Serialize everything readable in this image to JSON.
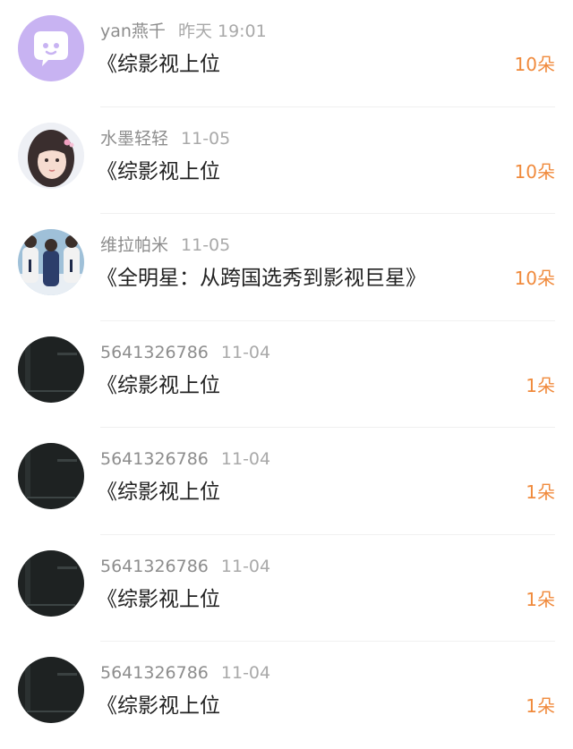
{
  "colors": {
    "accent": "#f08a3c",
    "name_text": "#8d8d8d",
    "title_text": "#222222",
    "divider": "#f0f0f0"
  },
  "gifts": [
    {
      "user": "yan燕千",
      "time": "昨天 19:01",
      "title": "《综影视上位",
      "amount": "10朵",
      "avatar": "purple-chat-bubble-avatar"
    },
    {
      "user": "水墨轻轻",
      "time": "11-05",
      "title": "《综影视上位",
      "amount": "10朵",
      "avatar": "girl-portrait-avatar"
    },
    {
      "user": "维拉帕米",
      "time": "11-05",
      "title": "《全明星：从跨国选秀到影视巨星》",
      "amount": "10朵",
      "avatar": "group-photo-avatar"
    },
    {
      "user": "5641326786",
      "time": "11-04",
      "title": "《综影视上位",
      "amount": "1朵",
      "avatar": "dark-image-avatar"
    },
    {
      "user": "5641326786",
      "time": "11-04",
      "title": "《综影视上位",
      "amount": "1朵",
      "avatar": "dark-image-avatar"
    },
    {
      "user": "5641326786",
      "time": "11-04",
      "title": "《综影视上位",
      "amount": "1朵",
      "avatar": "dark-image-avatar"
    },
    {
      "user": "5641326786",
      "time": "11-04",
      "title": "《综影视上位",
      "amount": "1朵",
      "avatar": "dark-image-avatar"
    }
  ]
}
